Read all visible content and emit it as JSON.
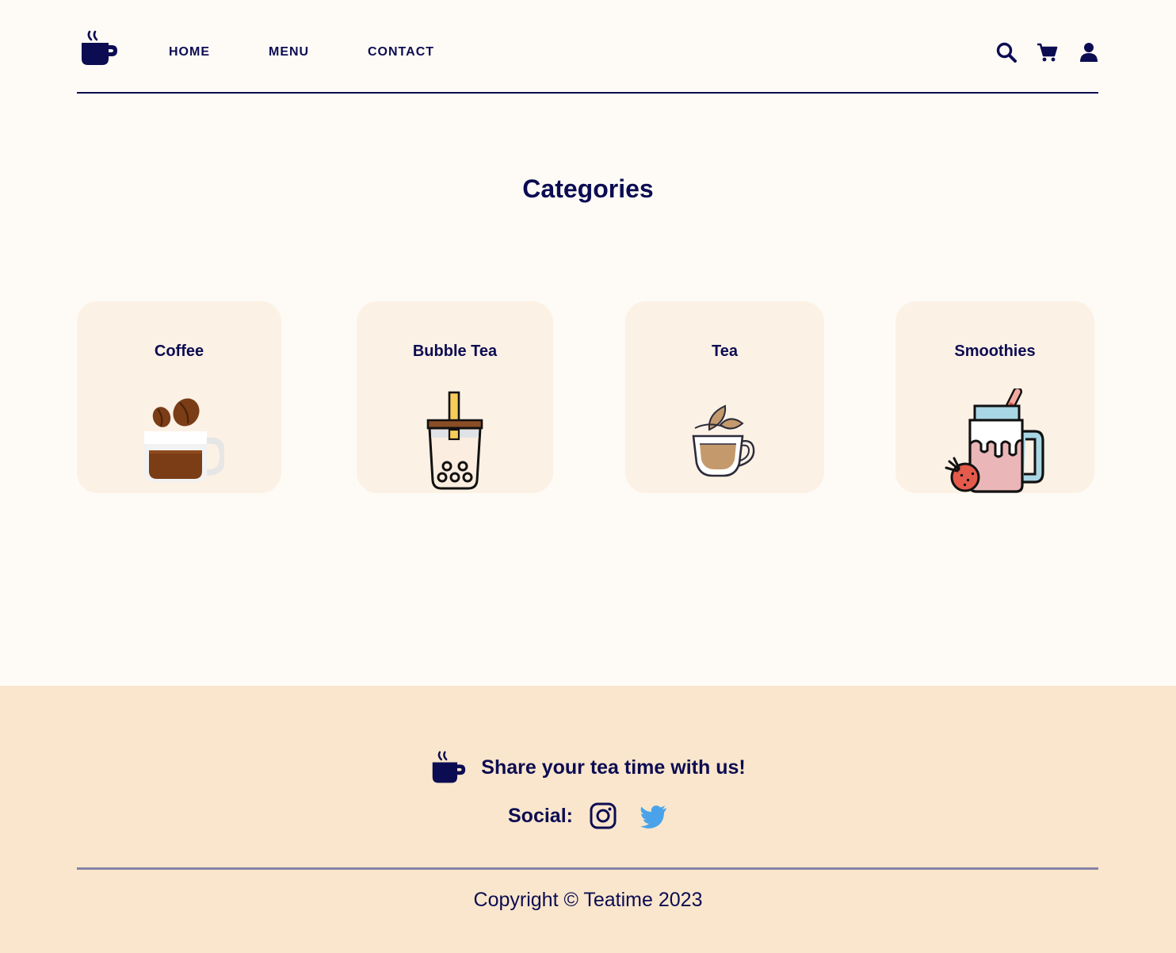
{
  "brand": {
    "logo_icon": "mug-logo-icon",
    "accent_color": "#0c0c52"
  },
  "nav": {
    "items": [
      {
        "label": "HOME"
      },
      {
        "label": "MENU"
      },
      {
        "label": "CONTACT"
      }
    ]
  },
  "header_icons": [
    "search-icon",
    "cart-icon",
    "user-icon"
  ],
  "categories": {
    "title": "Categories",
    "items": [
      {
        "label": "Coffee",
        "icon": "coffee-cup-icon"
      },
      {
        "label": "Bubble Tea",
        "icon": "bubble-tea-icon"
      },
      {
        "label": "Tea",
        "icon": "tea-cup-icon"
      },
      {
        "label": "Smoothies",
        "icon": "smoothie-jar-icon"
      }
    ],
    "card_color": "#fcf1e5"
  },
  "footer": {
    "share_text": "Share your tea time with us!",
    "social_label": "Social",
    "social_separator": ":",
    "social_icons": [
      "instagram-icon",
      "twitter-icon"
    ],
    "copyright": "Copyright © Teatime 2023",
    "background_color": "#f9e6cc"
  }
}
